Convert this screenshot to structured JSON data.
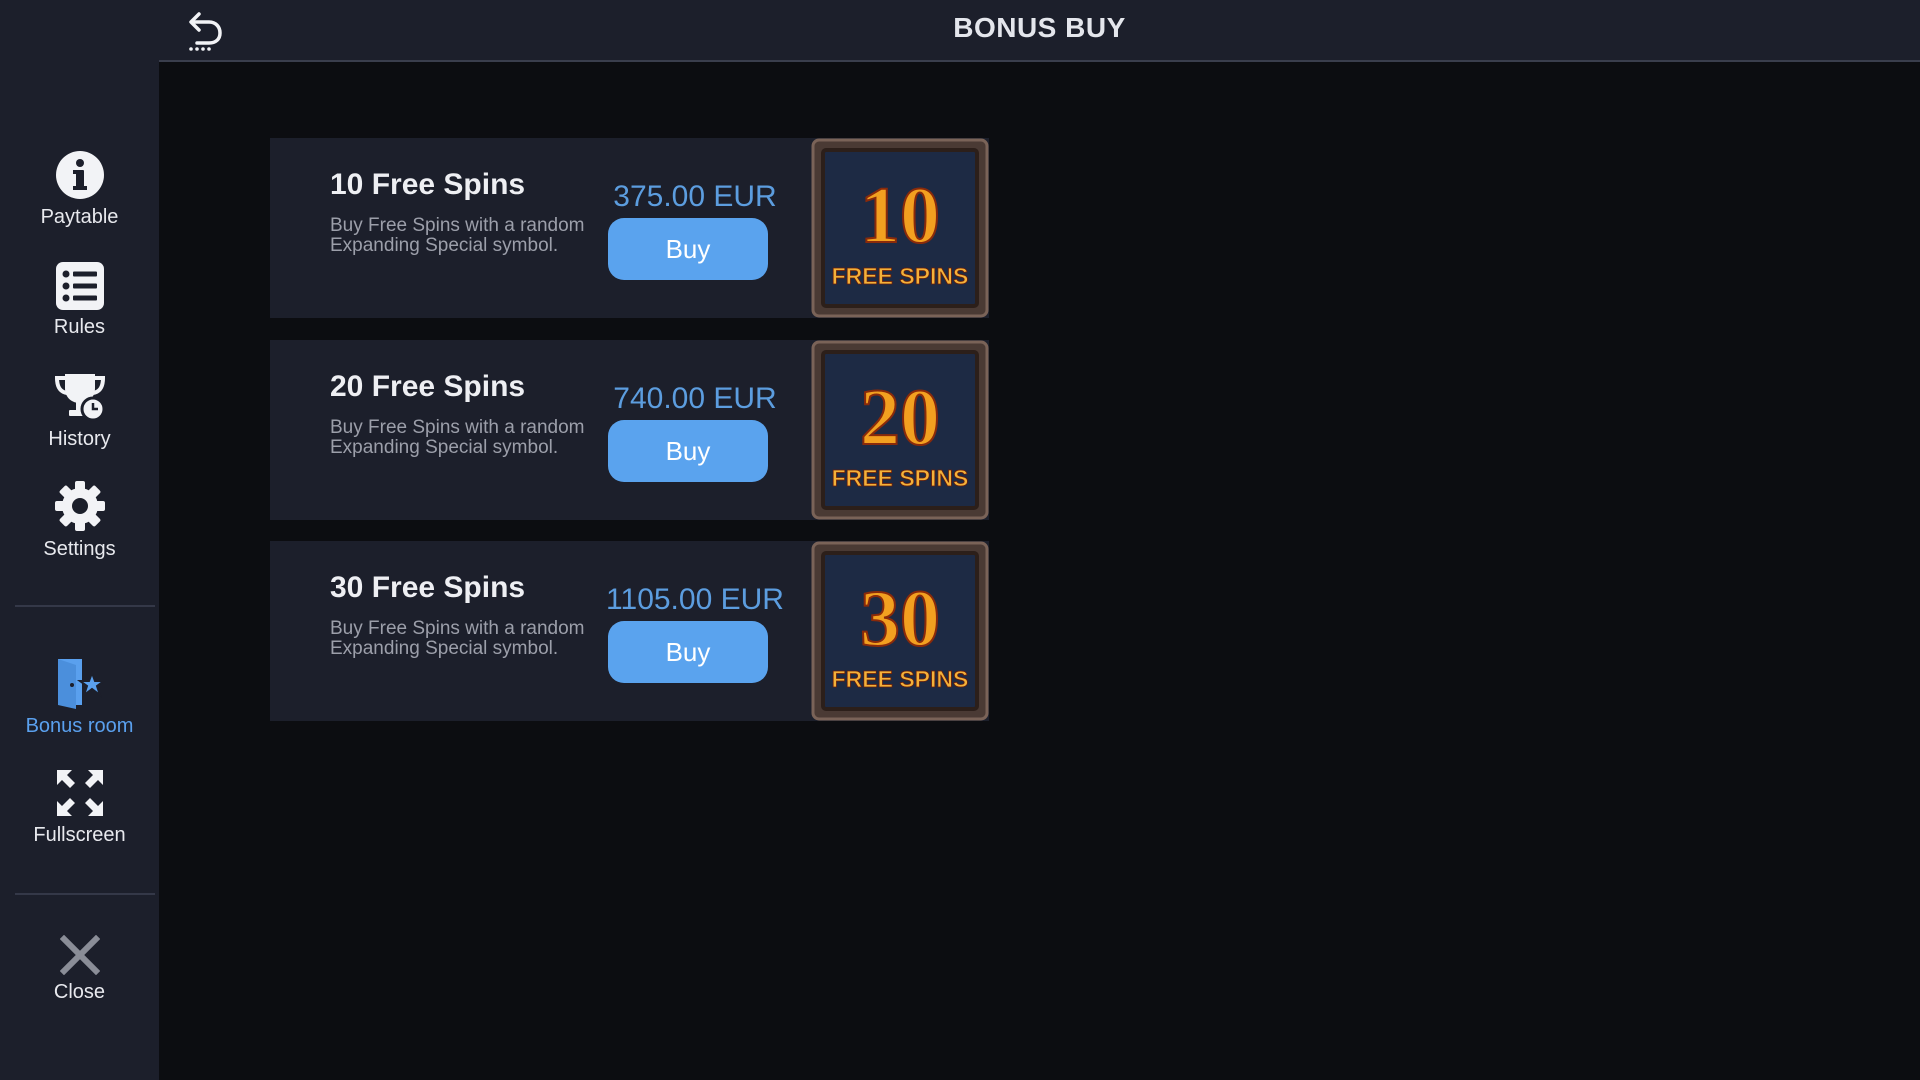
{
  "header": {
    "title": "BONUS BUY"
  },
  "sidebar": {
    "items": [
      {
        "label": "Paytable"
      },
      {
        "label": "Rules"
      },
      {
        "label": "History"
      },
      {
        "label": "Settings"
      },
      {
        "label": "Bonus room"
      },
      {
        "label": "Fullscreen"
      },
      {
        "label": "Close"
      }
    ]
  },
  "offers": [
    {
      "title": "10 Free Spins",
      "description": "Buy Free Spins with a random Expanding Special symbol.",
      "price": "375.00 EUR",
      "button": "Buy",
      "badge_number": "10",
      "badge_text": "FREE SPINS"
    },
    {
      "title": "20 Free Spins",
      "description": "Buy Free Spins with a random Expanding Special symbol.",
      "price": "740.00 EUR",
      "button": "Buy",
      "badge_number": "20",
      "badge_text": "FREE SPINS"
    },
    {
      "title": "30 Free Spins",
      "description": "Buy Free Spins with a random Expanding Special symbol.",
      "price": "1105.00 EUR",
      "button": "Buy",
      "badge_number": "30",
      "badge_text": "FREE SPINS"
    }
  ],
  "colors": {
    "background": "#0c0d11",
    "panel": "#1c1f2b",
    "accent": "#5aa3ee",
    "price": "#5c9ddf",
    "badge_number": "#f2a020"
  }
}
